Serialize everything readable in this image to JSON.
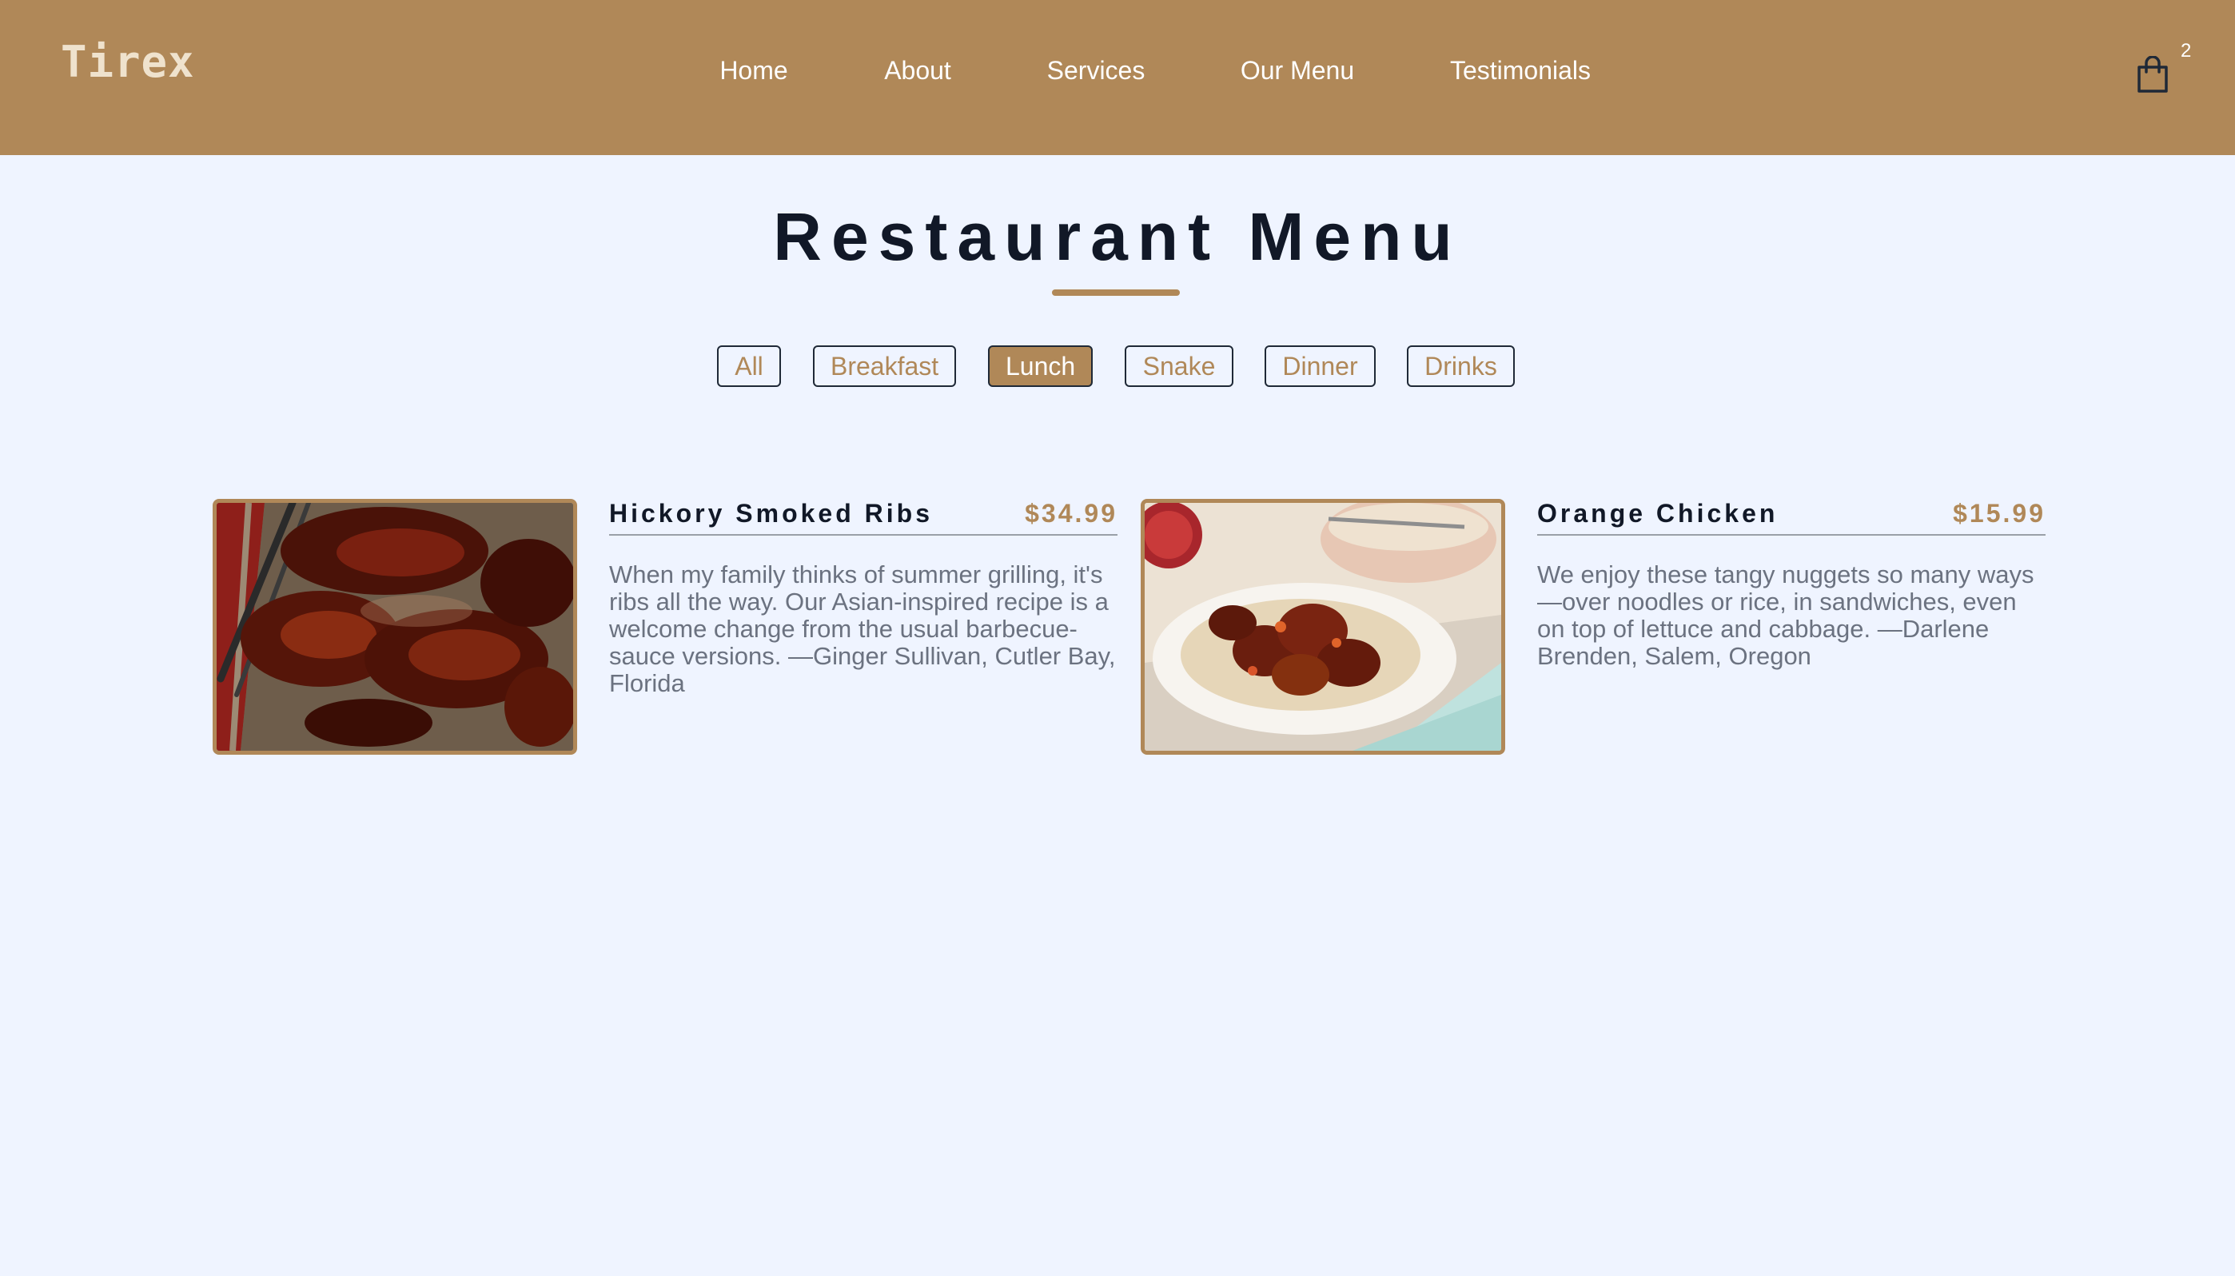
{
  "brand": {
    "logo": "Tirex"
  },
  "nav": {
    "items": [
      {
        "label": "Home"
      },
      {
        "label": "About"
      },
      {
        "label": "Services"
      },
      {
        "label": "Our Menu"
      },
      {
        "label": "Testimonials"
      }
    ]
  },
  "cart": {
    "icon": "shopping-bag-icon",
    "count": "2"
  },
  "menu": {
    "title": "Restaurant Menu",
    "filters": [
      {
        "label": "All"
      },
      {
        "label": "Breakfast"
      },
      {
        "label": "Lunch",
        "active": true
      },
      {
        "label": "Snake"
      },
      {
        "label": "Dinner"
      },
      {
        "label": "Drinks"
      }
    ],
    "items": [
      {
        "name": "Hickory Smoked Ribs",
        "price": "$34.99",
        "description": "When my family thinks of summer grilling, it's ribs all the way. Our Asian-inspired recipe is a welcome change from the usual barbecue-sauce versions. —Ginger Sullivan, Cutler Bay, Florida"
      },
      {
        "name": "Orange Chicken",
        "price": "$15.99",
        "description": "We enjoy these tangy nuggets so many ways—over noodles or rice, in sandwiches, even on top of lettuce and cabbage. —Darlene Brenden, Salem, Oregon"
      }
    ]
  },
  "colors": {
    "accent": "#b08858",
    "background": "#eff4ff",
    "heading": "#111827",
    "body_text": "#6b7280"
  }
}
